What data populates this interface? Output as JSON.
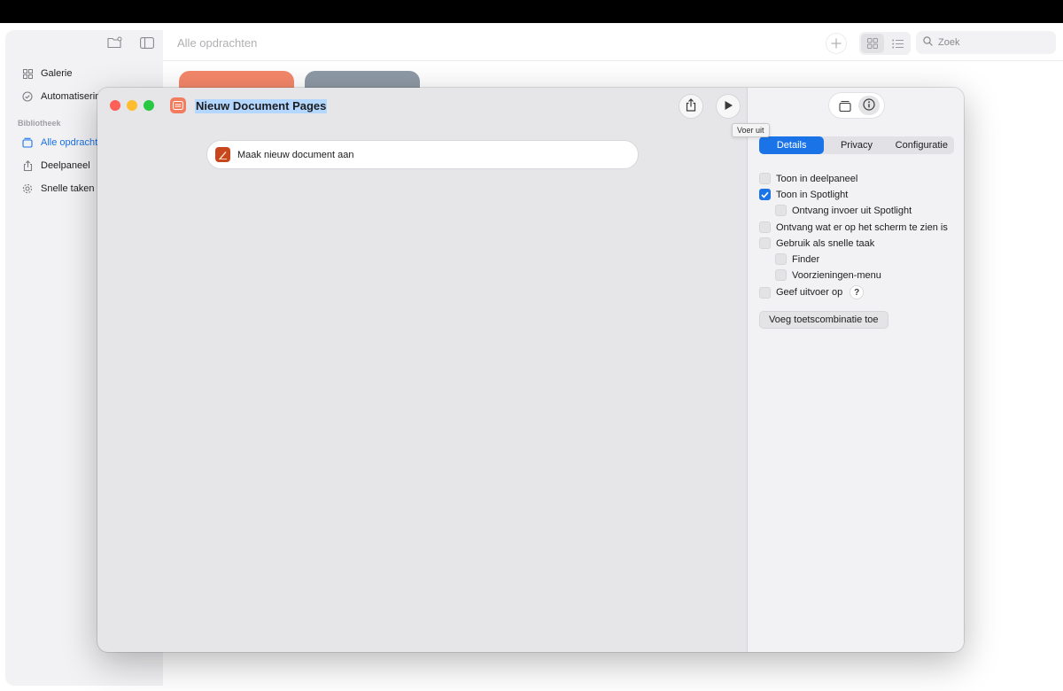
{
  "background_window": {
    "title": "Alle opdrachten",
    "sidebar": {
      "items": [
        {
          "label": "Galerie",
          "icon": "grid-icon"
        },
        {
          "label": "Automatisering",
          "icon": "clock-check-icon"
        }
      ],
      "section_label": "Bibliotheek",
      "library_items": [
        {
          "label": "Alle opdrachten",
          "icon": "stack-icon",
          "active": true
        },
        {
          "label": "Deelpaneel",
          "icon": "share-icon"
        },
        {
          "label": "Snelle taken",
          "icon": "gear-icon"
        }
      ]
    },
    "search": {
      "placeholder": "Zoek"
    },
    "card_colors": [
      "#f4876a",
      "#8e9aa6"
    ]
  },
  "editor": {
    "title": "Nieuw Document Pages",
    "app_icon_color": "#f37b5e",
    "action": {
      "label": "Maak nieuw document aan",
      "icon": "pages-icon"
    },
    "tooltip": "Voer uit",
    "inspector": {
      "tabs": [
        {
          "label": "Details",
          "active": true
        },
        {
          "label": "Privacy",
          "active": false
        },
        {
          "label": "Configuratie",
          "active": false
        }
      ],
      "options": [
        {
          "label": "Toon in deelpaneel",
          "checked": false,
          "indent": 0
        },
        {
          "label": "Toon in Spotlight",
          "checked": true,
          "indent": 0
        },
        {
          "label": "Ontvang invoer uit Spotlight",
          "checked": false,
          "indent": 1
        },
        {
          "label": "Ontvang wat er op het scherm te zien is",
          "checked": false,
          "indent": 0
        },
        {
          "label": "Gebruik als snelle taak",
          "checked": false,
          "indent": 0
        },
        {
          "label": "Finder",
          "checked": false,
          "indent": 1
        },
        {
          "label": "Voorzieningen-menu",
          "checked": false,
          "indent": 1
        },
        {
          "label": "Geef uitvoer op",
          "checked": false,
          "indent": 0
        }
      ],
      "help_label": "?",
      "shortcut_button": "Voeg toetscombinatie toe"
    }
  },
  "colors": {
    "accent": "#1a74e8",
    "close": "#fe5f57",
    "minimize": "#febc2e",
    "zoom": "#28c840"
  }
}
